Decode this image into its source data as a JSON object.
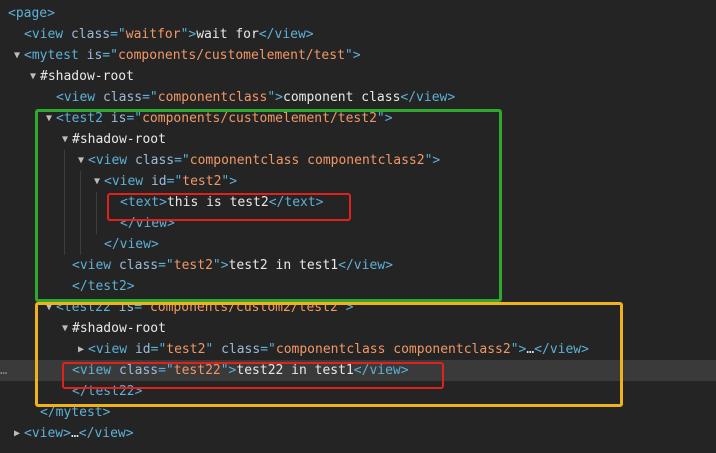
{
  "tree": [
    {
      "indent": 0,
      "toggle": "",
      "parts": [
        [
          "tag",
          "<page>"
        ]
      ]
    },
    {
      "indent": 1,
      "toggle": "",
      "parts": [
        [
          "tag",
          "<view "
        ],
        [
          "attr",
          "class"
        ],
        [
          "tag",
          "=\""
        ],
        [
          "val",
          "waitfor"
        ],
        [
          "tag",
          "\">"
        ],
        [
          "txt",
          "wait for"
        ],
        [
          "tag",
          "</view>"
        ]
      ]
    },
    {
      "indent": 1,
      "toggle": "open",
      "parts": [
        [
          "tag",
          "<mytest "
        ],
        [
          "attr",
          "is"
        ],
        [
          "tag",
          "=\""
        ],
        [
          "val",
          "components/customelement/test"
        ],
        [
          "tag",
          "\">"
        ]
      ]
    },
    {
      "indent": 2,
      "toggle": "open",
      "parts": [
        [
          "root",
          "#shadow-root"
        ]
      ]
    },
    {
      "indent": 3,
      "toggle": "",
      "parts": [
        [
          "tag",
          "<view "
        ],
        [
          "attr",
          "class"
        ],
        [
          "tag",
          "=\""
        ],
        [
          "val",
          "componentclass"
        ],
        [
          "tag",
          "\">"
        ],
        [
          "txt",
          "component class"
        ],
        [
          "tag",
          "</view>"
        ]
      ]
    },
    {
      "indent": 3,
      "toggle": "open",
      "parts": [
        [
          "tag",
          "<test2 "
        ],
        [
          "attr",
          "is"
        ],
        [
          "tag",
          "=\""
        ],
        [
          "val",
          "components/customelement/test2"
        ],
        [
          "tag",
          "\">"
        ]
      ]
    },
    {
      "indent": 4,
      "toggle": "open",
      "parts": [
        [
          "root",
          "#shadow-root"
        ]
      ]
    },
    {
      "indent": 5,
      "toggle": "open",
      "parts": [
        [
          "tag",
          "<view "
        ],
        [
          "attr",
          "class"
        ],
        [
          "tag",
          "=\""
        ],
        [
          "val",
          "componentclass componentclass2"
        ],
        [
          "tag",
          "\">"
        ]
      ]
    },
    {
      "indent": 6,
      "toggle": "open",
      "parts": [
        [
          "tag",
          "<view "
        ],
        [
          "attr",
          "id"
        ],
        [
          "tag",
          "=\""
        ],
        [
          "val",
          "test2"
        ],
        [
          "tag",
          "\">"
        ]
      ]
    },
    {
      "indent": 7,
      "toggle": "",
      "parts": [
        [
          "tag",
          "<text>"
        ],
        [
          "txt",
          "this is test2"
        ],
        [
          "tag",
          "</text>"
        ]
      ]
    },
    {
      "indent": 7,
      "toggle": "",
      "parts": [
        [
          "tag",
          "</view>"
        ]
      ]
    },
    {
      "indent": 6,
      "toggle": "",
      "parts": [
        [
          "tag",
          "</view>"
        ]
      ]
    },
    {
      "indent": 4,
      "toggle": "",
      "parts": [
        [
          "tag",
          "<view "
        ],
        [
          "attr",
          "class"
        ],
        [
          "tag",
          "=\""
        ],
        [
          "val",
          "test2"
        ],
        [
          "tag",
          "\">"
        ],
        [
          "txt",
          "test2 in test1"
        ],
        [
          "tag",
          "</view>"
        ]
      ]
    },
    {
      "indent": 4,
      "toggle": "",
      "parts": [
        [
          "tag",
          "</test2>"
        ]
      ]
    },
    {
      "indent": 3,
      "toggle": "open",
      "parts": [
        [
          "tag",
          "<test22 "
        ],
        [
          "attr",
          "is"
        ],
        [
          "tag",
          "=\""
        ],
        [
          "val",
          "components/custom2/test2"
        ],
        [
          "tag",
          "\">"
        ]
      ]
    },
    {
      "indent": 4,
      "toggle": "open",
      "parts": [
        [
          "root",
          "#shadow-root"
        ]
      ]
    },
    {
      "indent": 5,
      "toggle": "closed",
      "parts": [
        [
          "tag",
          "<view "
        ],
        [
          "attr",
          "id"
        ],
        [
          "tag",
          "=\""
        ],
        [
          "val",
          "test2"
        ],
        [
          "tag",
          "\" "
        ],
        [
          "attr",
          "class"
        ],
        [
          "tag",
          "=\""
        ],
        [
          "val",
          "componentclass componentclass2"
        ],
        [
          "tag",
          "\">"
        ],
        [
          "txt",
          "…"
        ],
        [
          "tag",
          "</view>"
        ]
      ]
    },
    {
      "indent": 4,
      "toggle": "",
      "selected": true,
      "parts": [
        [
          "tag",
          "<view "
        ],
        [
          "attr",
          "class"
        ],
        [
          "tag",
          "=\""
        ],
        [
          "val",
          "test22"
        ],
        [
          "tag",
          "\">"
        ],
        [
          "txt",
          "test22 in test1"
        ],
        [
          "tag",
          "</view>"
        ]
      ]
    },
    {
      "indent": 4,
      "toggle": "",
      "parts": [
        [
          "tag",
          "</test22>"
        ]
      ]
    },
    {
      "indent": 2,
      "toggle": "",
      "parts": [
        [
          "tag",
          "</mytest>"
        ]
      ]
    },
    {
      "indent": 1,
      "toggle": "closed",
      "parts": [
        [
          "tag",
          "<view>"
        ],
        [
          "txt",
          "…"
        ],
        [
          "tag",
          "</view>"
        ]
      ]
    }
  ],
  "selected_row_marker": "…",
  "colors": {
    "background": "#242424",
    "tag": "#5db0d7",
    "attribute": "#9bbbdc",
    "value": "#f29766",
    "text": "#e8e8e8",
    "highlight_green": "#2fa82f",
    "highlight_yellow": "#f0b21c",
    "highlight_red": "#e0221c"
  }
}
